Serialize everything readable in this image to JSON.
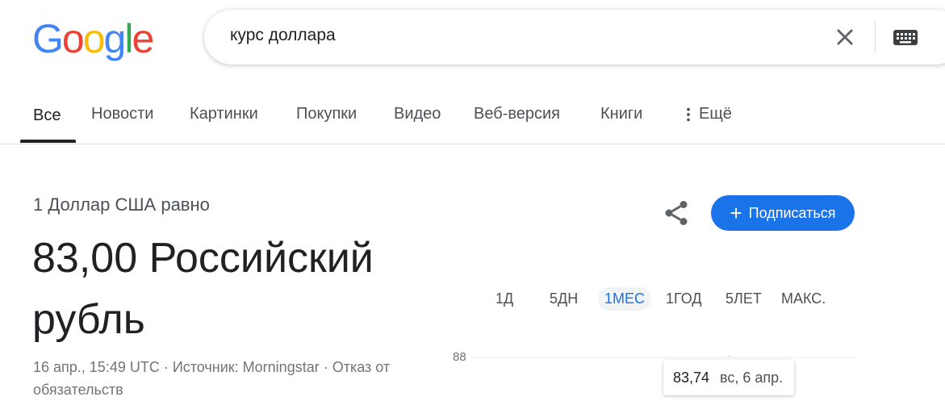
{
  "search": {
    "query": "курс доллара"
  },
  "logo": {
    "text": "Google",
    "colors": [
      "#4285F4",
      "#EA4335",
      "#FBBC05",
      "#4285F4",
      "#34A853",
      "#EA4335"
    ]
  },
  "tabs": [
    {
      "label": "Все",
      "active": true
    },
    {
      "label": "Новости"
    },
    {
      "label": "Картинки"
    },
    {
      "label": "Покупки"
    },
    {
      "label": "Видео"
    },
    {
      "label": "Веб-версия"
    },
    {
      "label": "Книги"
    },
    {
      "label": "Ещё"
    }
  ],
  "converter": {
    "from_label": "1 Доллар США равно",
    "result": "83,00 Российский рубль",
    "meta": "16 апр., 15:49 UTC · Источник: Morningstar · Отказ от обязательств"
  },
  "actions": {
    "subscribe_label": "Подписаться"
  },
  "ranges": [
    {
      "label": "1Д"
    },
    {
      "label": "5ДН"
    },
    {
      "label": "1МЕС",
      "active": true
    },
    {
      "label": "1ГОД"
    },
    {
      "label": "5ЛЕТ"
    },
    {
      "label": "МАКС."
    }
  ],
  "chart_data": {
    "type": "line",
    "y_tick_labels": [
      "88"
    ],
    "tooltip": {
      "value": "83,74",
      "date": "вс, 6 апр."
    }
  },
  "colors": {
    "accent": "#1a73e8",
    "text": "#202124",
    "muted": "#4d5156"
  }
}
